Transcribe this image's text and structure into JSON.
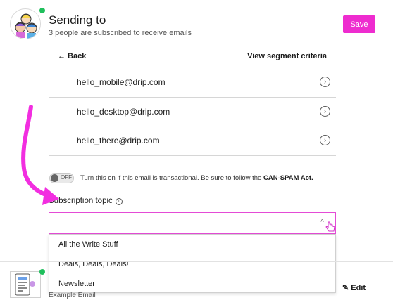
{
  "header": {
    "title": "Sending to",
    "subtitle": "3 people are subscribed to receive emails",
    "save_label": "Save",
    "accent_color": "#ee2ccf"
  },
  "nav": {
    "back_label": "← Back",
    "view_criteria_label": "View segment criteria"
  },
  "recipients": [
    {
      "email": "hello_mobile@drip.com",
      "icon": "chevron-right-icon"
    },
    {
      "email": "hello_desktop@drip.com",
      "icon": "chevron-right-icon"
    },
    {
      "email": "hello_there@drip.com",
      "icon": "chevron-right-icon"
    }
  ],
  "transactional": {
    "toggle_label": "OFF",
    "toggle_state": "off",
    "description": "Turn this on if this email is transactional. Be sure to follow the",
    "link_text": " CAN-SPAM Act."
  },
  "subscription": {
    "label": "Subscription topic",
    "info_glyph": "i",
    "selected_value": "",
    "options": [
      "All the Write Stuff",
      "Deals, Deals, Deals!",
      "Newsletter"
    ]
  },
  "email_section": {
    "example_label": "Example Email",
    "edit_label": "Edit"
  },
  "icons": {
    "chevron": "›",
    "caret_up": "^"
  }
}
